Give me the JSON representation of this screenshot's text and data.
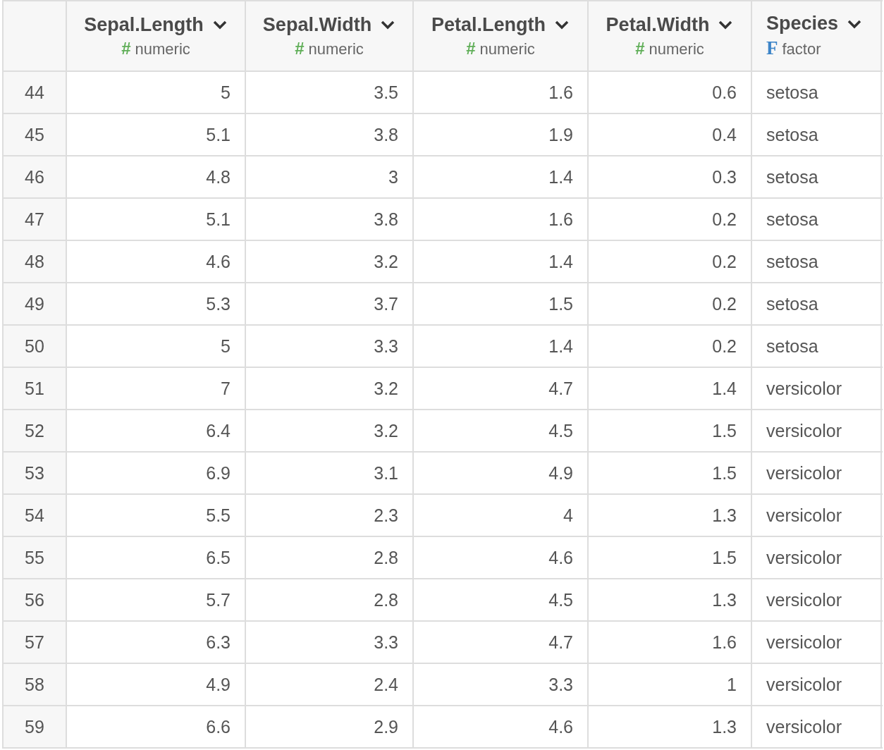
{
  "table": {
    "columns": [
      {
        "name": "Sepal.Length",
        "kind": "numeric",
        "type_glyph": "#",
        "type_label": "numeric"
      },
      {
        "name": "Sepal.Width",
        "kind": "numeric",
        "type_glyph": "#",
        "type_label": "numeric"
      },
      {
        "name": "Petal.Length",
        "kind": "numeric",
        "type_glyph": "#",
        "type_label": "numeric"
      },
      {
        "name": "Petal.Width",
        "kind": "numeric",
        "type_glyph": "#",
        "type_label": "numeric"
      },
      {
        "name": "Species",
        "kind": "factor",
        "type_glyph": "F",
        "type_label": "factor"
      }
    ],
    "rows": [
      {
        "index": "44",
        "cells": [
          "5",
          "3.5",
          "1.6",
          "0.6",
          "setosa"
        ]
      },
      {
        "index": "45",
        "cells": [
          "5.1",
          "3.8",
          "1.9",
          "0.4",
          "setosa"
        ]
      },
      {
        "index": "46",
        "cells": [
          "4.8",
          "3",
          "1.4",
          "0.3",
          "setosa"
        ]
      },
      {
        "index": "47",
        "cells": [
          "5.1",
          "3.8",
          "1.6",
          "0.2",
          "setosa"
        ]
      },
      {
        "index": "48",
        "cells": [
          "4.6",
          "3.2",
          "1.4",
          "0.2",
          "setosa"
        ]
      },
      {
        "index": "49",
        "cells": [
          "5.3",
          "3.7",
          "1.5",
          "0.2",
          "setosa"
        ]
      },
      {
        "index": "50",
        "cells": [
          "5",
          "3.3",
          "1.4",
          "0.2",
          "setosa"
        ]
      },
      {
        "index": "51",
        "cells": [
          "7",
          "3.2",
          "4.7",
          "1.4",
          "versicolor"
        ]
      },
      {
        "index": "52",
        "cells": [
          "6.4",
          "3.2",
          "4.5",
          "1.5",
          "versicolor"
        ]
      },
      {
        "index": "53",
        "cells": [
          "6.9",
          "3.1",
          "4.9",
          "1.5",
          "versicolor"
        ]
      },
      {
        "index": "54",
        "cells": [
          "5.5",
          "2.3",
          "4",
          "1.3",
          "versicolor"
        ]
      },
      {
        "index": "55",
        "cells": [
          "6.5",
          "2.8",
          "4.6",
          "1.5",
          "versicolor"
        ]
      },
      {
        "index": "56",
        "cells": [
          "5.7",
          "2.8",
          "4.5",
          "1.3",
          "versicolor"
        ]
      },
      {
        "index": "57",
        "cells": [
          "6.3",
          "3.3",
          "4.7",
          "1.6",
          "versicolor"
        ]
      },
      {
        "index": "58",
        "cells": [
          "4.9",
          "2.4",
          "3.3",
          "1",
          "versicolor"
        ]
      },
      {
        "index": "59",
        "cells": [
          "6.6",
          "2.9",
          "4.6",
          "1.3",
          "versicolor"
        ]
      }
    ]
  }
}
